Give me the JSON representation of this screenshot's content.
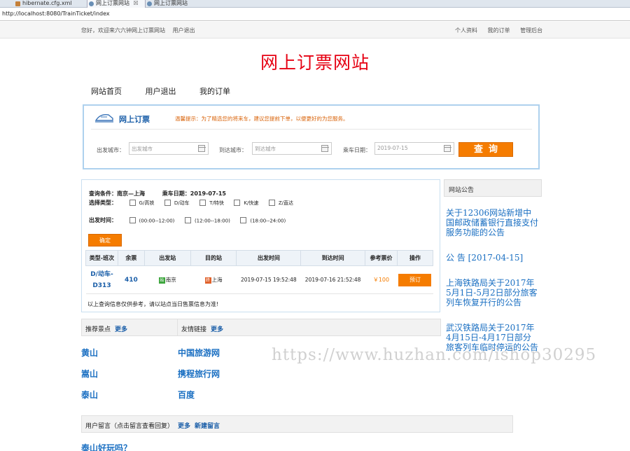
{
  "browser": {
    "tabs": [
      "hibernate.cfg.xml",
      "网上订票网站",
      "网上订票网站"
    ],
    "tab_close": "☒",
    "url": "http://localhost:8080/TrainTicket/index"
  },
  "topbar": {
    "greeting": "您好，欢迎来六六钟网上订票网站",
    "logout": "用户退出",
    "links": [
      "个人资料",
      "我的订单",
      "管理后台"
    ]
  },
  "site_title": "网上订票网站",
  "nav": [
    "网站首页",
    "用户退出",
    "我的订单"
  ],
  "booking": {
    "title": "网上订票",
    "tip": "温馨提示：为了精选您的将来车，建议您提前下单，以便更好的为您服务。",
    "from_label": "出发城市：",
    "from_placeholder": "出发城市",
    "to_label": "到达城市：",
    "to_placeholder": "到达城市",
    "date_label": "乘车日期：",
    "date_value": "2019-07-15",
    "search_label": "查询"
  },
  "results": {
    "query_label": "查询条件：南京—上海",
    "date_label": "乘车日期：2019-07-15",
    "type_label": "选择类型：",
    "types": [
      "G/高铁",
      "D/动车",
      "T/特快",
      "K/快速",
      "Z/直达"
    ],
    "time_label": "出发时间：",
    "times": [
      "(00:00--12:00)",
      "(12:00--18:00)",
      "(18:00--24:00)"
    ],
    "confirm_label": "确定",
    "columns": [
      "类型-班次",
      "余票",
      "出发站",
      "目的站",
      "出发时间",
      "到达时间",
      "参考票价",
      "操作"
    ],
    "rows": [
      {
        "train": "D/动车-D313",
        "seats": "410",
        "start_badge": "始",
        "from": "南京",
        "end_badge": "终",
        "to": "上海",
        "depart": "2019-07-15 19:52:48",
        "arrive": "2019-07-16 21:52:48",
        "price": "￥100",
        "action": "预订"
      }
    ],
    "notice": "以上查询信息仅供参考，请以站点当日售票信息为准!"
  },
  "announcements": {
    "title": "网站公告",
    "items": [
      "关于12306网站新增中国邮政储蓄银行直接支付服务功能的公告",
      "公 告 [2017-04-15]",
      "上海铁路局关于2017年5月1日-5月2日部分旅客列车恢复开行的公告",
      "武汉铁路局关于2017年4月15日-4月17日部分旅客列车临时停运的公告"
    ]
  },
  "recommend": {
    "title": "推荐景点",
    "more": "更多",
    "items": [
      "黄山",
      "嵩山",
      "泰山"
    ]
  },
  "friends": {
    "title": "友情链接",
    "more": "更多",
    "items": [
      "中国旅游网",
      "携程旅行网",
      "百度"
    ]
  },
  "messages": {
    "title": "用户留言（点击留言查看回复）",
    "more": "更多",
    "new": "新建留言",
    "first": "泰山好玩吗？"
  },
  "watermark": "https://www.huzhan.com/ishop30295"
}
